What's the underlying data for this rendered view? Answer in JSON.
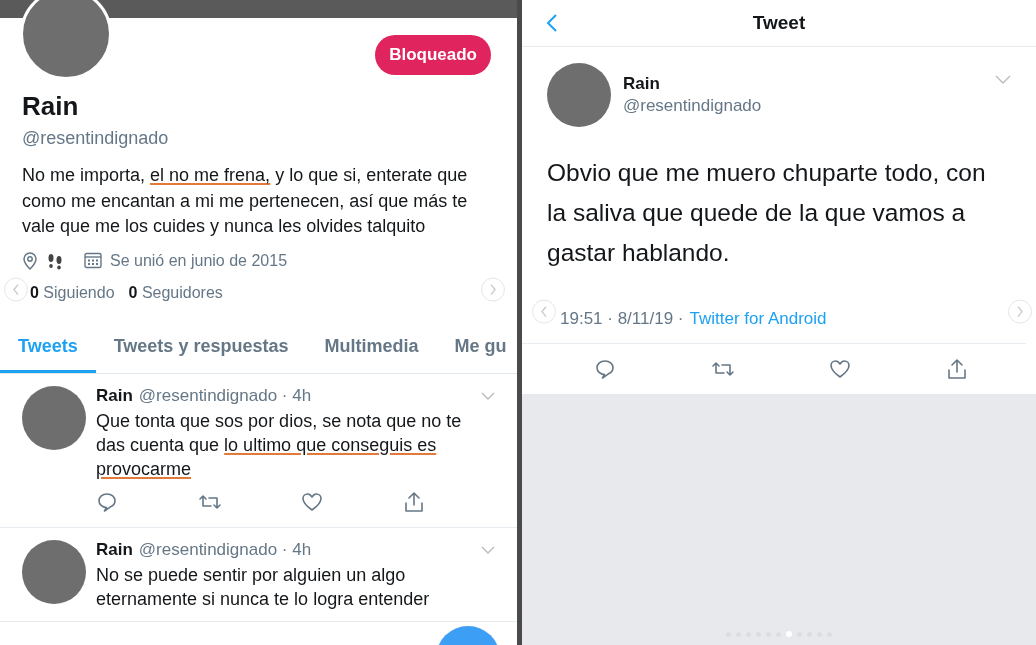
{
  "profile_screen": {
    "block_button": "Bloqueado",
    "name": "Rain",
    "handle": "@resentindignado",
    "bio": [
      {
        "text": "No me importa, ",
        "marked": false
      },
      {
        "text": "el no me frena,",
        "marked": true
      },
      {
        "text": " y lo que si, enterate que como me encantan a mi me pertenecen, así que más te vale que me los cuides y nunca les olvides talquito",
        "marked": false
      }
    ],
    "joined": "Se unió en junio de 2015",
    "stats": [
      {
        "count": "0",
        "label": "Siguiendo"
      },
      {
        "count": "0",
        "label": "Seguidores"
      }
    ],
    "tabs": [
      {
        "label": "Tweets",
        "selected": true
      },
      {
        "label": "Tweets y respuestas",
        "selected": false
      },
      {
        "label": "Multimedia",
        "selected": false
      },
      {
        "label": "Me gu",
        "selected": false
      }
    ],
    "tweets": [
      {
        "name": "Rain",
        "meta": "@resentindignado · 4h",
        "text": [
          {
            "text": "Que tonta que sos por dios, se nota que no te das cuenta que ",
            "marked": false
          },
          {
            "text": "lo ultimo que conseguis es provocarme",
            "marked": true
          }
        ],
        "actions": true
      },
      {
        "name": "Rain",
        "meta": "@resentindignado · 4h",
        "text": [
          {
            "text": "No se puede sentir por alguien un algo eternamente si nunca te lo logra entender",
            "marked": false
          }
        ],
        "actions": false
      }
    ]
  },
  "tweet_screen": {
    "title": "Tweet",
    "name": "Rain",
    "handle": "@resentindignado",
    "text": "Obvio que me muero chuparte todo, con la saliva que quede de la que vamos a gastar hablando.",
    "time": "19:51 · 8/11/19 ·",
    "source": "Twitter for Android"
  },
  "carousel": {
    "dots": [
      {
        "selected": false
      },
      {
        "selected": false
      },
      {
        "selected": false
      },
      {
        "selected": false
      },
      {
        "selected": false
      },
      {
        "selected": false
      },
      {
        "selected": true
      },
      {
        "selected": false
      },
      {
        "selected": false
      },
      {
        "selected": false
      },
      {
        "selected": false
      }
    ]
  }
}
